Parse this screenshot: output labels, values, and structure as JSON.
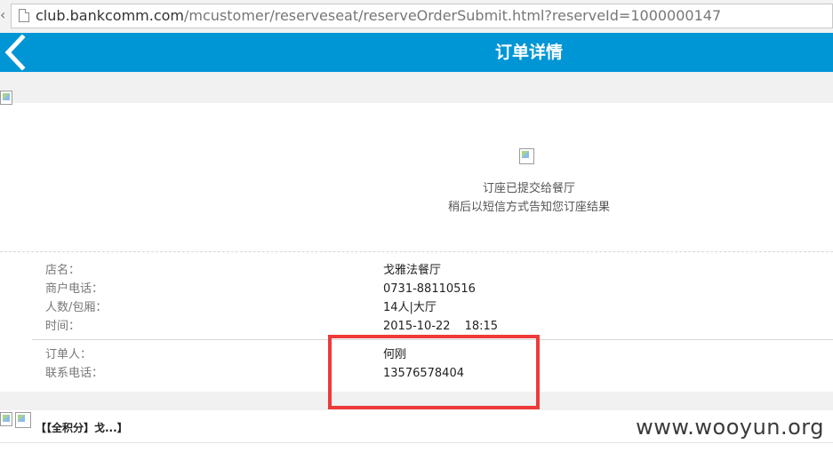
{
  "browser": {
    "url_host": "club.bankcomm.com",
    "url_rest": "/mcustomer/reserveseat/reserveOrderSubmit.html?reserveId=1000000147"
  },
  "header": {
    "title": "订单详情",
    "background": "#0096d6"
  },
  "status": {
    "line1": "订座已提交给餐厅",
    "line2": "稍后以短信方式告知您订座结果"
  },
  "details": [
    {
      "label": "店名：",
      "value": "戈雅法餐厅"
    },
    {
      "label": "商户电话：",
      "value": "0731-88110516"
    },
    {
      "label": "人数/包厢：",
      "value": "14人|大厅"
    },
    {
      "label": "时间：",
      "date": "2015-10-22",
      "time": "18:15"
    }
  ],
  "contact": [
    {
      "label": "订单人：",
      "value": "何刚"
    },
    {
      "label": "联系电话：",
      "value": "13576578404"
    }
  ],
  "bottom": {
    "item_text": "【【全积分】戈...】"
  },
  "watermark": "www.wooyun.org",
  "colors": {
    "highlight": "#ef3a3a",
    "gray_band": "#f1f1f1"
  }
}
